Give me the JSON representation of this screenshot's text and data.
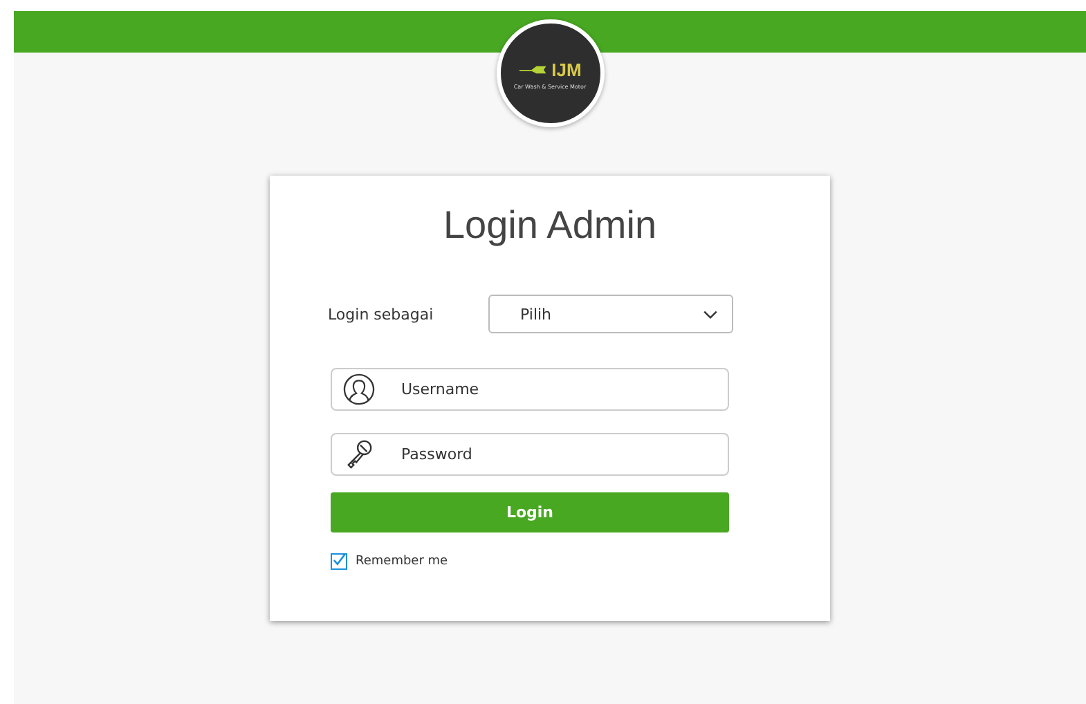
{
  "logo": {
    "brand": "IJM",
    "tagline": "Car Wash & Service Motor"
  },
  "title": "Login Admin",
  "role": {
    "label": "Login sebagai",
    "value": "Pilih"
  },
  "username": {
    "placeholder": "Username"
  },
  "password": {
    "placeholder": "Password"
  },
  "login_button": "Login",
  "remember": {
    "label": "Remember me",
    "checked": true
  }
}
